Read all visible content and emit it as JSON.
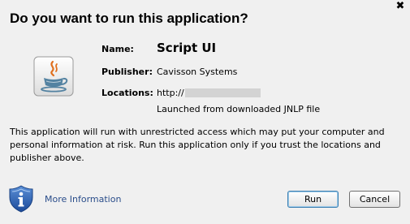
{
  "dialog": {
    "title": "Do you want to run this application?",
    "close_glyph": "✖"
  },
  "app": {
    "icon": "java-cup-icon",
    "name_label": "Name:",
    "name_value": "Script UI",
    "publisher_label": "Publisher:",
    "publisher_value": "Cavisson Systems",
    "locations_label": "Locations:",
    "locations_value": "http://",
    "launched_note": "Launched from downloaded JNLP file"
  },
  "warning": {
    "text": "This application will run with unrestricted access which may put your computer and personal information at risk. Run this application only if you trust the locations and publisher above."
  },
  "footer": {
    "info_icon": "shield-info-icon",
    "more_info_label": "More Information",
    "run_label": "Run",
    "cancel_label": "Cancel"
  },
  "colors": {
    "background": "#f0f0f0",
    "link": "#2a4d8a",
    "shield_blue": "#2d5fae"
  }
}
